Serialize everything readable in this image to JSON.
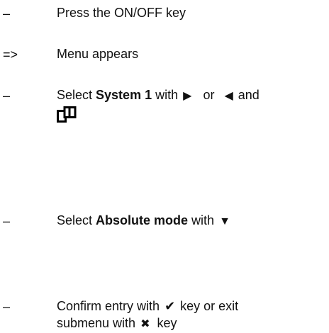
{
  "steps": [
    {
      "bullet": "–",
      "text": "Press the ON/OFF key"
    },
    {
      "bullet": "=>",
      "text": "Menu appears"
    },
    {
      "bullet": "–",
      "pre": "Select ",
      "bold": "System 1",
      "mid": " with",
      "or": "or",
      "post": "and"
    },
    {
      "bullet": "–",
      "pre": "Select ",
      "bold": "Absolute mode",
      "mid": " with"
    },
    {
      "bullet": "–",
      "line1_pre": "Confirm entry with",
      "line1_post": " key or exit",
      "line2_pre": "submenu with",
      "line2_post": "key"
    }
  ],
  "icons": {
    "right": "▶",
    "left": "◀",
    "down": "▼",
    "check": "✔",
    "cross": "✖",
    "screens": "screens-icon"
  }
}
